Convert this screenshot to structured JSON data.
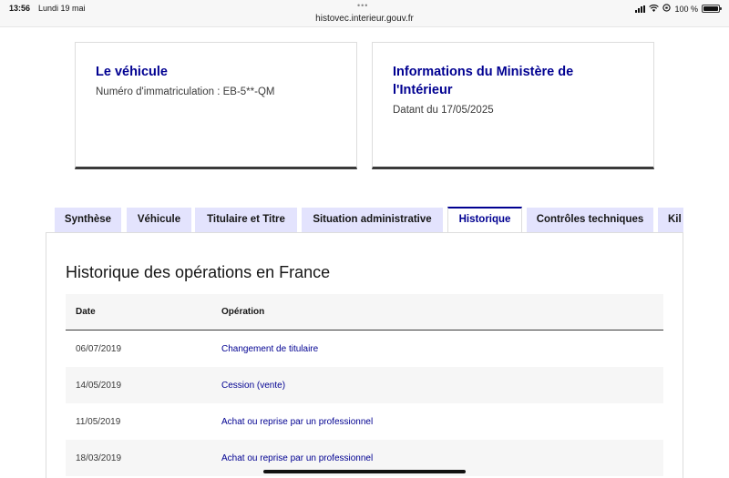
{
  "status_bar": {
    "time": "13:56",
    "date": "Lundi 19 mai",
    "url": "histovec.interieur.gouv.fr",
    "battery": "100 %",
    "battery_level": 1.0
  },
  "cards": {
    "vehicle": {
      "title": "Le véhicule",
      "text": "Numéro d'immatriculation : EB-5**-QM"
    },
    "ministry": {
      "title_line1": "Informations du Ministère de",
      "title_line2": "l'Intérieur",
      "text": "Datant du 17/05/2025"
    }
  },
  "tabs": [
    "Synthèse",
    "Véhicule",
    "Titulaire et Titre",
    "Situation administrative",
    "Historique",
    "Contrôles techniques",
    "Kil"
  ],
  "active_tab": "Historique",
  "history": {
    "title": "Historique des opérations en France",
    "columns": {
      "date": "Date",
      "operation": "Opération"
    },
    "rows": [
      {
        "date": "06/07/2019",
        "operation": "Changement de titulaire"
      },
      {
        "date": "14/05/2019",
        "operation": "Cession (vente)"
      },
      {
        "date": "11/05/2019",
        "operation": "Achat ou reprise par un professionnel"
      },
      {
        "date": "18/03/2019",
        "operation": "Achat ou reprise par un professionnel"
      }
    ]
  },
  "colors": {
    "primary": "#000091",
    "tab_bg": "#e3e3fd",
    "row_alt": "#f6f6f6"
  }
}
